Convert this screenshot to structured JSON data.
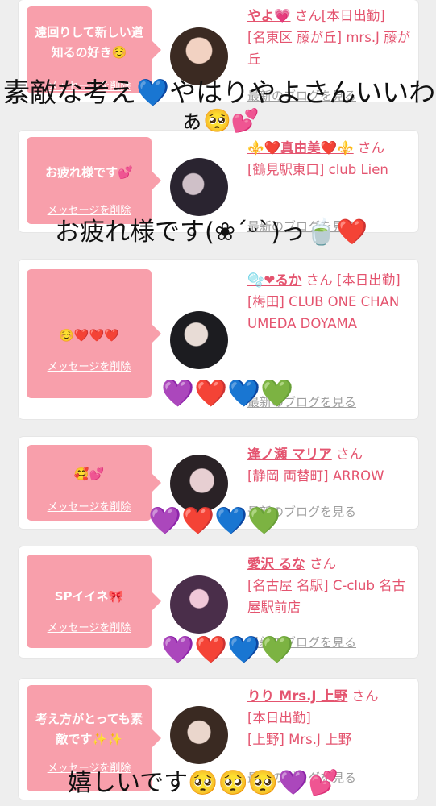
{
  "cards": [
    {
      "message": "遠回りして新しい道知るの好き☺️",
      "delete_label": "メッセージを削除",
      "name": "やよ💗",
      "san": "さん",
      "status": "[本日出勤]",
      "area": "[名東区 藤が丘] mrs.J 藤が丘",
      "blog": "最新のブログを見る"
    },
    {
      "message": "お疲れ様です💕",
      "delete_label": "メッセージを削除",
      "name": "⚜️❤️真由美❤️⚜️",
      "san": "さん",
      "area": "[鶴見駅東口] club Lien",
      "blog": "最新のブログを見る"
    },
    {
      "message": "☺️❤️❤️❤️",
      "delete_label": "メッセージを削除",
      "name": "🫧❤るか",
      "san": "さん",
      "status": "[本日出勤]",
      "area": "[梅田] CLUB ONE CHAN UMEDA DOYAMA",
      "blog": "最新のブログを見る"
    },
    {
      "message": "🥰💕",
      "delete_label": "メッセージを削除",
      "name": "逢ノ瀬 マリア",
      "san": "さん",
      "area": "[静岡 両替町] ARROW",
      "blog": "最新のブログを見る"
    },
    {
      "message": "SPイイネ🎀",
      "delete_label": "メッセージを削除",
      "name": "愛沢 るな",
      "san": "さん",
      "area": "[名古屋 名駅] C-club 名古屋駅前店",
      "blog": "最新のブログを見る"
    },
    {
      "message": "考え方がとっても素敵です✨✨",
      "delete_label": "メッセージを削除",
      "name": "りり Mrs.J 上野",
      "san": "さん",
      "status": "[本日出勤]",
      "area": "[上野] Mrs.J 上野",
      "blog": "最新のブログを見る"
    }
  ],
  "overlays": {
    "top_line1": "素敵な考え💙やはりやよさんいいわ",
    "top_line2": "ぁ🥺💕",
    "mid": "お疲れ様です(❀ˊᵕˋ)っ🍵❤️",
    "hearts": "💜❤️💙💚",
    "bottom": "嬉しいです🥺🥺🥺💜💕"
  },
  "colors": {
    "bubble": "#f89fab",
    "accent": "#e4546f",
    "background": "#eeeeee"
  }
}
